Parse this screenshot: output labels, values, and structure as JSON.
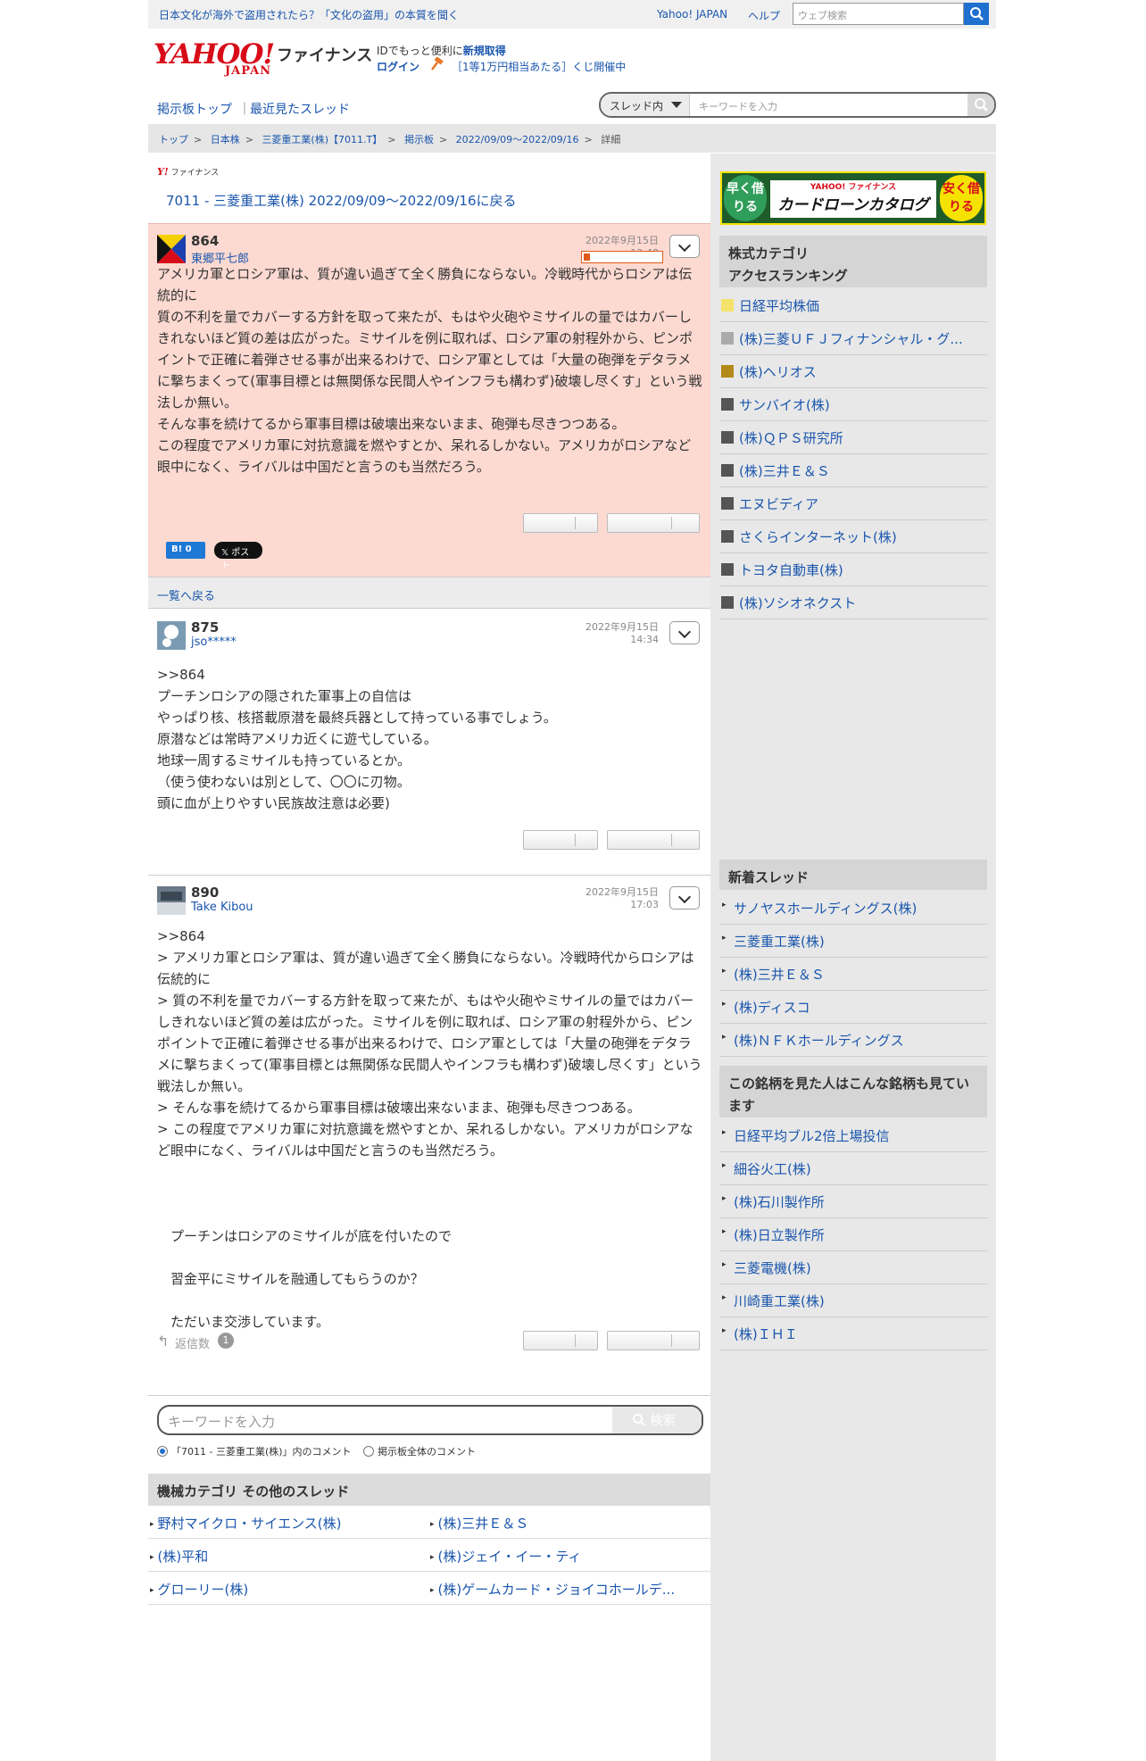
{
  "topbar": {
    "notice": "日本文化が海外で盗用されたら？「文化の盗用」の本質を聞く",
    "yahoo_japan": "Yahoo! JAPAN",
    "help": "ヘルプ",
    "search_placeholder": "ウェブ検索"
  },
  "header": {
    "logo_yahoo": "YAHOO!",
    "logo_japan": "JAPAN",
    "logo_finance": "ファイナンス",
    "id_text": "IDでもっと便利に",
    "id_link": "新規取得",
    "login": "ログイン",
    "kuji": "［1等1万円相当あたる］くじ開催中"
  },
  "nav": {
    "board_top": "掲示板トップ",
    "sep": "｜",
    "recent": "最近見たスレッド",
    "scope": "スレッド内",
    "search_placeholder": "キーワードを入力"
  },
  "breadcrumb": [
    "トップ",
    "日本株",
    "三菱重工業(株)【7011.T】",
    "掲示板",
    "2022/09/09〜2022/09/16",
    "詳細"
  ],
  "main": {
    "mini_logo_y": "Y!",
    "mini_logo_fin": "ファイナンス",
    "back_link": "7011 - 三菱重工業(株) 2022/09/09〜2022/09/16に戻る",
    "list_back": "一覧へ戻る",
    "hatena": "B! 0",
    "tweet": "𝕏 ポスト",
    "reply_label": "返信数",
    "reply_count": "1"
  },
  "posts": [
    {
      "num": "864",
      "author": "東郷平七郎",
      "date": "2022年9月15日 13:48",
      "body": "アメリカ軍とロシア軍は、質が違い過ぎて全く勝負にならない。冷戦時代からロシアは伝統的に\n質の不利を量でカバーする方針を取って来たが、もはや火砲やミサイルの量ではカバーしきれないほど質の差は広がった。ミサイルを例に取れば、ロシア軍の射程外から、ピンポイントで正確に着弾させる事が出来るわけで、ロシア軍としては「大量の砲弾をデタラメに撃ちまくって(軍事目標とは無関係な民間人やインフラも構わず)破壊し尽くす」という戦法しか無い。\nそんな事を続けてるから軍事目標は破壊出来ないまま、砲弾も尽きつつある。\nこの程度でアメリカ軍に対抗意識を燃やすとか、呆れるしかない。アメリカがロシアなど眼中になく、ライバルは中国だと言うのも当然だろう。"
    },
    {
      "num": "875",
      "author": "jso*****",
      "date": "2022年9月15日 14:34",
      "body": ">>864\nプーチンロシアの隠された軍事上の自信は\nやっぱり核、核搭載原潜を最終兵器として持っている事でしょう。\n原潜などは常時アメリカ近くに遊弋している。\n地球一周するミサイルも持っているとか。\n（使う使わないは別として、〇〇に刃物。\n頭に血が上りやすい民族故注意は必要)"
    },
    {
      "num": "890",
      "author": "Take Kibou",
      "date": "2022年9月15日 17:03",
      "body": ">>864\n> アメリカ軍とロシア軍は、質が違い過ぎて全く勝負にならない。冷戦時代からロシアは伝統的に\n> 質の不利を量でカバーする方針を取って来たが、もはや火砲やミサイルの量ではカバーしきれないほど質の差は広がった。ミサイルを例に取れば、ロシア軍の射程外から、ピンポイントで正確に着弾させる事が出来るわけで、ロシア軍としては「大量の砲弾をデタラメに撃ちまくって(軍事目標とは無関係な民間人やインフラも構わず)破壊し尽くす」という戦法しか無い。\n> そんな事を続けてるから軍事目標は破壊出来ないまま、砲弾も尽きつつある。\n> この程度でアメリカ軍に対抗意識を燃やすとか、呆れるしかない。アメリカがロシアなど眼中になく、ライバルは中国だと言うのも当然だろう。\n\n\n\n　プーチンはロシアのミサイルが底を付いたので\n\n　習金平にミサイルを融通してもらうのか？\n\n　ただいま交渉しています。"
    }
  ],
  "bottom_search": {
    "placeholder": "キーワードを入力",
    "button": "検索",
    "scope_thread": "「7011 - 三菱重工業(株)」内のコメント",
    "scope_all": "掲示板全体のコメント"
  },
  "other_threads": {
    "title": "機械カテゴリ その他のスレッド",
    "items": [
      "野村マイクロ・サイエンス(株)",
      "(株)三井Ｅ＆Ｓ",
      "(株)平和",
      "(株)ジェイ・イー・ティ",
      "グローリー(株)",
      "(株)ゲームカード・ジョイコホールデ..."
    ]
  },
  "sidebar": {
    "banner_left": "早く借りる",
    "banner_brand": "YAHOO! ファイナンス",
    "banner_title": "カードローンカタログ",
    "banner_right": "安く借りる",
    "ranking_title": "株式カテゴリ\nアクセスランキング",
    "ranking": [
      "日経平均株価",
      "(株)三菱ＵＦＪフィナンシャル・グ...",
      "(株)ヘリオス",
      "サンバイオ(株)",
      "(株)ＱＰＳ研究所",
      "(株)三井Ｅ＆Ｓ",
      "エヌビディア",
      "さくらインターネット(株)",
      "トヨタ自動車(株)",
      "(株)ソシオネクスト"
    ],
    "ranking_colors": [
      "#f5e26a",
      "#aaaaaa",
      "#b38a1a",
      "#555555",
      "#555555",
      "#555555",
      "#555555",
      "#555555",
      "#555555",
      "#555555"
    ],
    "new_title": "新着スレッド",
    "new_threads": [
      "サノヤスホールディングス(株)",
      "三菱重工業(株)",
      "(株)三井Ｅ＆Ｓ",
      "(株)ディスコ",
      "(株)ＮＦＫホールディングス"
    ],
    "viewed_title": "この銘柄を見た人はこんな銘柄も見ています",
    "viewed": [
      "日経平均ブル2倍上場投信",
      "細谷火工(株)",
      "(株)石川製作所",
      "(株)日立製作所",
      "三菱電機(株)",
      "川崎重工業(株)",
      "(株)ＩＨＩ"
    ]
  }
}
